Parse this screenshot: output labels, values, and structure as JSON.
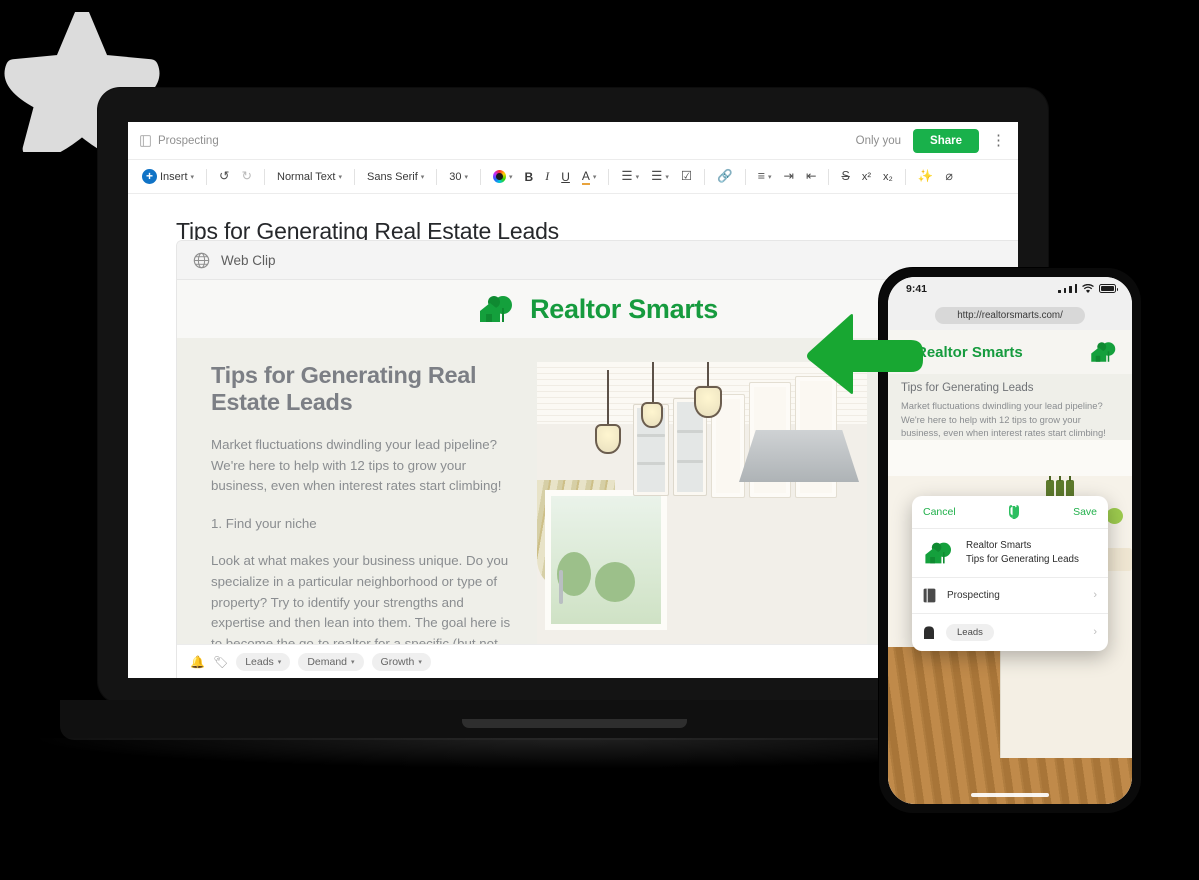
{
  "desktop": {
    "breadcrumb": "Prospecting",
    "topbar": {
      "presence": "Only you",
      "share_label": "Share",
      "kebab": "⋮"
    },
    "toolbar": {
      "insert_label": "Insert",
      "style": "Normal Text",
      "font": "Sans Serif",
      "size": "30",
      "bold": "B",
      "italic": "I",
      "underline": "U",
      "highlight": "A",
      "superscript": "x²",
      "subscript": "x₂"
    },
    "document_title": "Tips for Generating Real Estate Leads",
    "tagbar": {
      "tags": [
        "Leads",
        "Demand",
        "Growth"
      ]
    }
  },
  "webclip": {
    "header_label": "Web Clip",
    "brand": "Realtor Smarts",
    "heading": "Tips for Generating Real Estate Leads",
    "paragraphs": [
      "Market fluctuations dwindling your lead pipeline? We're here to help with 12 tips to grow your business, even when interest rates start climbing!",
      "1. Find your niche",
      "Look at what makes your business unique. Do you specialize in a particular neighborhood or type of property? Try to identify your strengths and expertise and then lean into them. The goal here is to become the go-to realtor for a specific (but not"
    ]
  },
  "phone": {
    "status": {
      "time": "9:41"
    },
    "url": "http://realtorsmarts.com/",
    "brand": "Realtor Smarts",
    "heading": "Tips for Generating Leads",
    "body": "Market fluctuations dwindling your lead pipeline? We're here to help with 12 tips to grow your business, even when interest rates start climbing!",
    "sheet": {
      "cancel": "Cancel",
      "save": "Save",
      "note_title": "Realtor Smarts",
      "note_subtitle": "Tips for Generating Leads",
      "notebook": "Prospecting",
      "tag": "Leads",
      "chevron": "›"
    }
  },
  "colors": {
    "brand_green": "#169b3e",
    "share_green": "#19b14b",
    "arrow_green": "#18a732",
    "insert_blue": "#1073c6",
    "page_background": "#000000",
    "star_gray": "#dcdcdc"
  }
}
